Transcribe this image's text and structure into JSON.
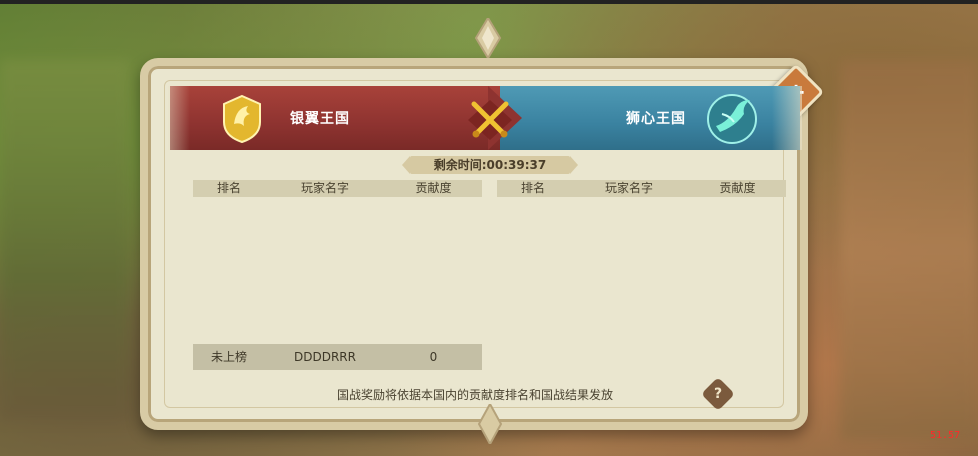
{
  "kingdoms": {
    "left": {
      "name": "银翼王国",
      "color": "#8e3330"
    },
    "right": {
      "name": "狮心王国",
      "color": "#3a82a0"
    }
  },
  "timer": {
    "text": "剩余时间:00:39:37"
  },
  "table_left": {
    "headers": [
      "排名",
      "玩家名字",
      "贡献度"
    ],
    "rows": []
  },
  "table_right": {
    "headers": [
      "排名",
      "玩家名字",
      "贡献度"
    ],
    "rows": []
  },
  "my_rank": {
    "rank": "未上榜",
    "player": "DDDDRRR",
    "contribution": "0"
  },
  "footer": {
    "text": "国战奖励将依据本国内的贡献度排名和国战结果发放"
  },
  "buttons": {
    "close_icon": "plus-close-icon",
    "help_icon": "question-icon",
    "help_glyph": "?",
    "close_glyph": "+"
  },
  "fps": "51.57"
}
